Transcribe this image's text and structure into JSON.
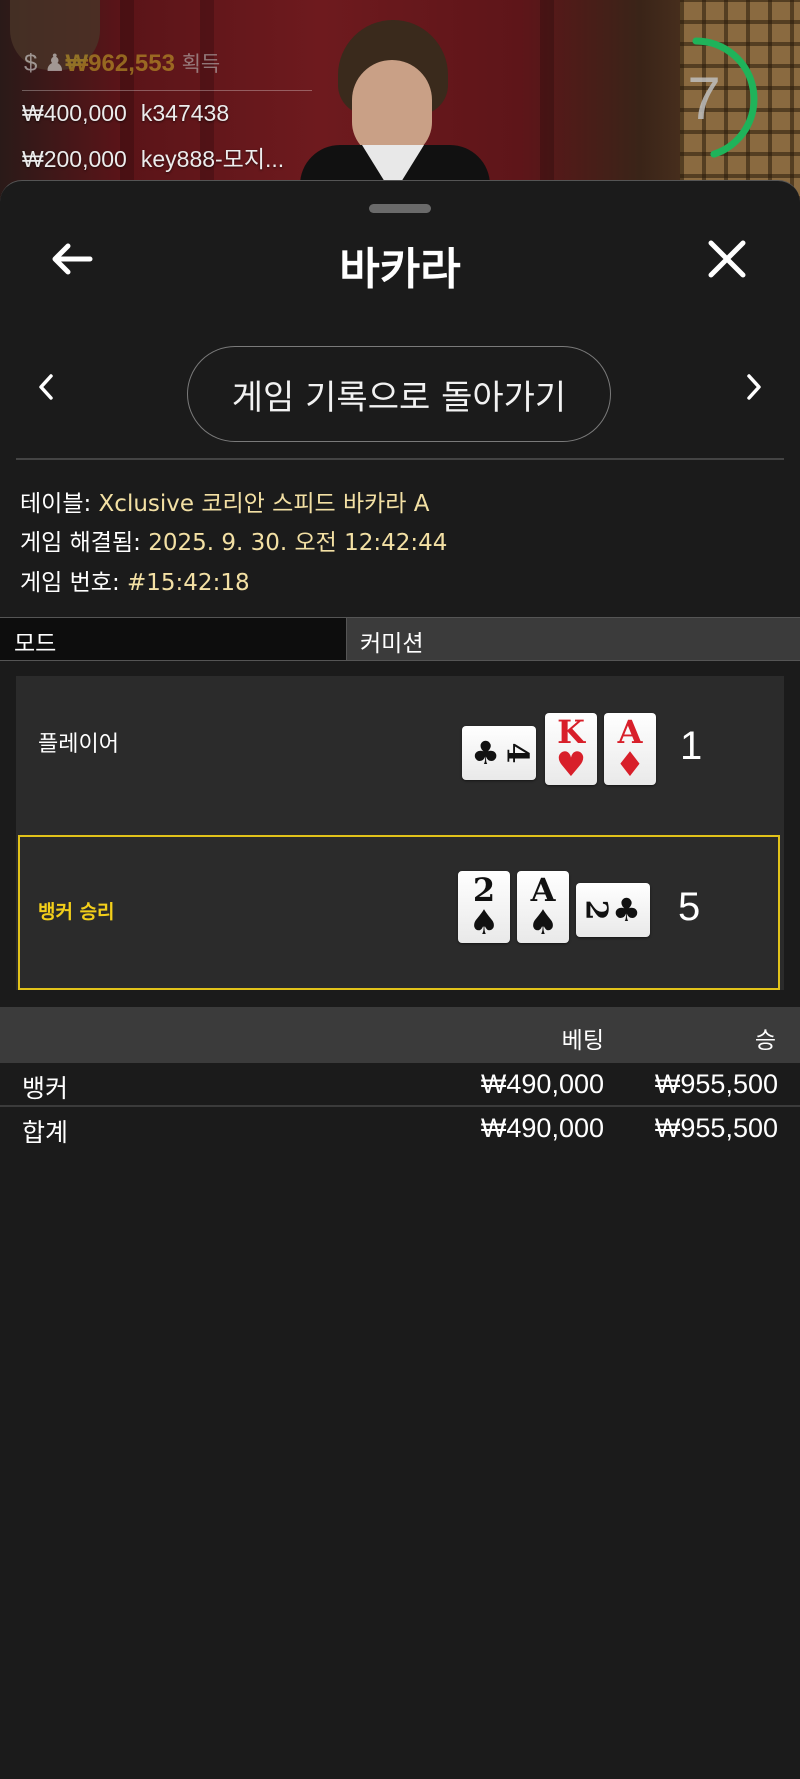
{
  "video": {
    "win_amount": "₩962,553",
    "win_label": "획득",
    "feed": [
      {
        "amount": "₩400,000",
        "user": "k347438"
      },
      {
        "amount": "₩200,000",
        "user": "key888-모지..."
      }
    ],
    "countdown": "7",
    "countdown_fraction": 0.45,
    "timer_color": "#1fb35a"
  },
  "header": {
    "title": "바카라",
    "back_icon": "arrow-left-icon",
    "close_icon": "close-icon"
  },
  "nav": {
    "back_to_history": "게임 기록으로 돌아가기",
    "prev_icon": "chevron-left-icon",
    "next_icon": "chevron-right-icon"
  },
  "info": {
    "table_label": "테이블:",
    "table_value": "Xclusive 코리안 스피드 바카라 A",
    "resolved_label": "게임 해결됨:",
    "resolved_value": "2025. 9. 30. 오전 12:42:44",
    "game_no_label": "게임 번호:",
    "game_no_value": "#15:42:18"
  },
  "mode": {
    "mode_label": "모드",
    "commission_label": "커미션"
  },
  "result": {
    "player": {
      "label": "플레이어",
      "score": "1",
      "cards": [
        {
          "rank": "4",
          "suit": "♣",
          "color": "black",
          "orientation": "horizontal"
        },
        {
          "rank": "K",
          "suit": "♥",
          "color": "red",
          "orientation": "vertical"
        },
        {
          "rank": "A",
          "suit": "♦",
          "color": "red",
          "orientation": "vertical"
        }
      ]
    },
    "banker": {
      "label": "뱅커 승리",
      "score": "5",
      "highlight_color": "#e1c21a",
      "cards": [
        {
          "rank": "2",
          "suit": "♠",
          "color": "black",
          "orientation": "vertical"
        },
        {
          "rank": "A",
          "suit": "♠",
          "color": "black",
          "orientation": "vertical"
        },
        {
          "rank": "2",
          "suit": "♣",
          "color": "black",
          "orientation": "horizontal"
        }
      ]
    }
  },
  "bets": {
    "col_bet": "베팅",
    "col_win": "승",
    "rows": [
      {
        "name": "뱅커",
        "bet": "₩490,000",
        "win": "₩955,500"
      },
      {
        "name": "합계",
        "bet": "₩490,000",
        "win": "₩955,500"
      }
    ]
  }
}
